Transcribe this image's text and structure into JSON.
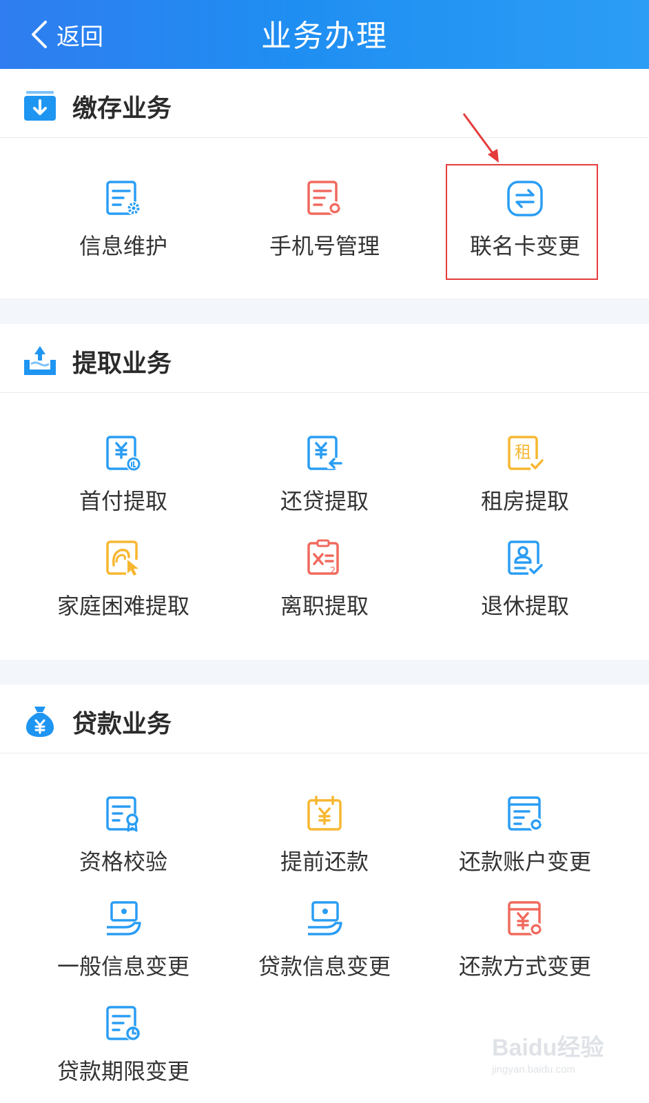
{
  "header": {
    "back_label": "返回",
    "title": "业务办理"
  },
  "sections": [
    {
      "title": "缴存业务",
      "icon": "deposit-download-icon",
      "items": [
        {
          "label": "信息维护",
          "icon": "document-gear-icon",
          "color": "#2a9df4"
        },
        {
          "label": "手机号管理",
          "icon": "document-refresh-icon",
          "color": "#f06a5e"
        },
        {
          "label": "联名卡变更",
          "icon": "card-transfer-icon",
          "color": "#2a9df4"
        }
      ]
    },
    {
      "title": "提取业务",
      "icon": "withdraw-tray-icon",
      "items": [
        {
          "label": "首付提取",
          "icon": "yuan-pay-icon",
          "color": "#2a9df4"
        },
        {
          "label": "还贷提取",
          "icon": "yuan-return-icon",
          "color": "#2a9df4"
        },
        {
          "label": "租房提取",
          "icon": "rent-check-icon",
          "color": "#f7b731"
        },
        {
          "label": "家庭困难提取",
          "icon": "hand-pointer-icon",
          "color": "#f7b731"
        },
        {
          "label": "离职提取",
          "icon": "resign-clipboard-icon",
          "color": "#f06a5e"
        },
        {
          "label": "退休提取",
          "icon": "person-check-icon",
          "color": "#2a9df4"
        }
      ]
    },
    {
      "title": "贷款业务",
      "icon": "money-bag-icon",
      "items": [
        {
          "label": "资格校验",
          "icon": "document-badge-icon",
          "color": "#2a9df4"
        },
        {
          "label": "提前还款",
          "icon": "calendar-yuan-icon",
          "color": "#f7b731"
        },
        {
          "label": "还款账户变更",
          "icon": "document-refresh-icon",
          "color": "#2a9df4"
        },
        {
          "label": "一般信息变更",
          "icon": "cash-hand-icon",
          "color": "#2a9df4"
        },
        {
          "label": "贷款信息变更",
          "icon": "cash-hand-icon",
          "color": "#2a9df4"
        },
        {
          "label": "还款方式变更",
          "icon": "yuan-refresh-icon",
          "color": "#f06a5e"
        },
        {
          "label": "贷款期限变更",
          "icon": "document-clock-icon",
          "color": "#2a9df4"
        }
      ]
    }
  ],
  "watermark": {
    "logo": "Baidu经验",
    "url": "jingyan.baidu.com"
  }
}
